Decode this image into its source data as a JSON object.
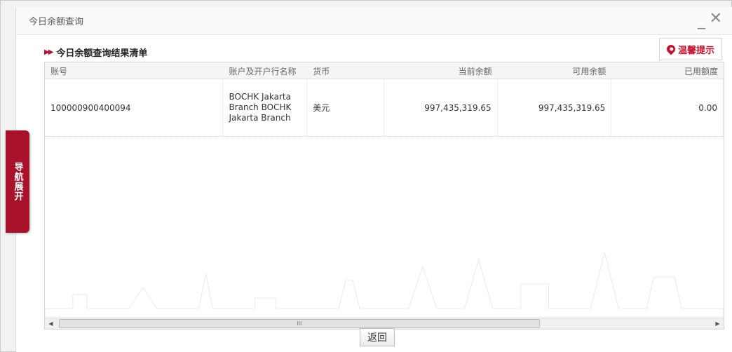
{
  "window": {
    "title": "今日余额查询",
    "minimize_glyph": "_",
    "close_glyph": "✕"
  },
  "section": {
    "title": "今日余额查询结果清单",
    "arrow_icon": "double-arrow-icon"
  },
  "tips_button": {
    "label": "温馨提示",
    "icon": "pin-icon",
    "color": "#c8102e"
  },
  "table": {
    "columns": [
      "账号",
      "账户及开户行名称",
      "货币",
      "当前余额",
      "可用余额",
      "已用额度"
    ],
    "rows": [
      {
        "account": "100000900400094",
        "bank_name": "BOCHK Jakarta Branch BOCHK Jakarta Branch",
        "currency": "美元",
        "current_balance": "997,435,319.65",
        "available_balance": "997,435,319.65",
        "used_amount": "0.00"
      }
    ]
  },
  "scrollbar": {
    "left_arrow": "◀",
    "right_arrow": "▶",
    "thumb_grip": "III"
  },
  "back_button": {
    "label": "返回"
  },
  "nav_tab": {
    "label": "导航展开",
    "color": "#a8132b"
  }
}
